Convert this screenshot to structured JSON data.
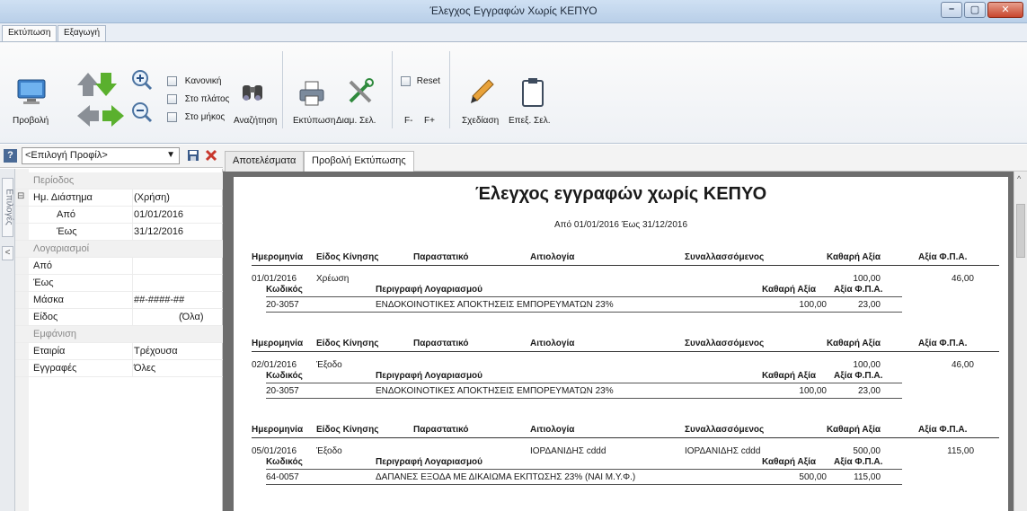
{
  "window": {
    "title": "Έλεγχος Εγγραφών Χωρίς ΚΕΠΥΟ"
  },
  "ribbon_tabs": [
    "Εκτύπωση",
    "Εξαγωγή"
  ],
  "ribbon": {
    "preview": "Προβολή",
    "zoom_normal": "Κανονική",
    "zoom_width": "Στο πλάτος",
    "zoom_length": "Στο μήκος",
    "search": "Αναζήτηση",
    "print": "Εκτύπωση",
    "page_setup": "Διαμ. Σελ.",
    "reset": "Reset",
    "font_minus": "F-",
    "font_plus": "F+",
    "design": "Σχεδίαση",
    "select_page": "Επεξ. Σελ."
  },
  "profile": {
    "selected": "<Επιλογή Προφίλ>"
  },
  "side_tab": "Επιλογές",
  "properties": [
    {
      "type": "cat",
      "key": "Περίοδος"
    },
    {
      "type": "row",
      "key": "Ημ. Διάστημα",
      "value": "(Χρήση)",
      "expand": "⊟"
    },
    {
      "type": "row",
      "key": "Από",
      "value": "01/01/2016",
      "indent": true
    },
    {
      "type": "row",
      "key": "Έως",
      "value": "31/12/2016",
      "indent": true
    },
    {
      "type": "cat",
      "key": "Λογαριασμοί"
    },
    {
      "type": "row",
      "key": "Από",
      "value": ""
    },
    {
      "type": "row",
      "key": "Έως",
      "value": ""
    },
    {
      "type": "row",
      "key": "Μάσκα",
      "value": "##-####-##"
    },
    {
      "type": "row",
      "key": "Είδος",
      "value": "(Όλα)",
      "center": true
    },
    {
      "type": "cat",
      "key": "Εμφάνιση"
    },
    {
      "type": "row",
      "key": "Εταιρία",
      "value": "Τρέχουσα"
    },
    {
      "type": "row",
      "key": "Εγγραφές",
      "value": "Όλες"
    }
  ],
  "doc_tabs": [
    "Αποτελέσματα",
    "Προβολή Εκτύπωσης"
  ],
  "report": {
    "title": "Έλεγχος εγγραφών χωρίς ΚΕΠΥΟ",
    "subtitle": "Από 01/01/2016 Έως 31/12/2016",
    "headers": {
      "date": "Ημερομηνία",
      "movement": "Είδος Κίνησης",
      "document": "Παραστατικό",
      "reason": "Αιτιολογία",
      "party": "Συναλλασσόμενος",
      "net": "Καθαρή Αξία",
      "vat": "Αξία Φ.Π.Α."
    },
    "sub_headers": {
      "code": "Κωδικός",
      "account_desc": "Περιγραφή Λογαριασμού",
      "net": "Καθαρή Αξία",
      "vat": "Αξία Φ.Π.Α."
    },
    "entries": [
      {
        "date": "01/01/2016",
        "movement": "Χρέωση",
        "reason": "",
        "party": "",
        "net": "100,00",
        "vat": "46,00",
        "code": "20-3057",
        "desc": "ΕΝΔΟΚΟΙΝΟΤΙΚΕΣ ΑΠΟΚΤΗΣΕΙΣ ΕΜΠΟΡΕΥΜΑΤΩΝ 23%",
        "line_net": "100,00",
        "line_vat": "23,00"
      },
      {
        "date": "02/01/2016",
        "movement": "Έξοδο",
        "reason": "",
        "party": "",
        "net": "100,00",
        "vat": "46,00",
        "code": "20-3057",
        "desc": "ΕΝΔΟΚΟΙΝΟΤΙΚΕΣ ΑΠΟΚΤΗΣΕΙΣ ΕΜΠΟΡΕΥΜΑΤΩΝ 23%",
        "line_net": "100,00",
        "line_vat": "23,00"
      },
      {
        "date": "05/01/2016",
        "movement": "Έξοδο",
        "reason": "ΙΟΡΔΑΝΙΔΗΣ cddd",
        "party": "ΙΟΡΔΑΝΙΔΗΣ cddd",
        "net": "500,00",
        "vat": "115,00",
        "code": "64-0057",
        "desc": "ΔΑΠΑΝΕΣ ΕΞΟΔΑ ΜΕ ΔΙΚΑΙΩΜΑ ΕΚΠΤΩΣΗΣ 23% (ΝΑΙ Μ.Υ.Φ.)",
        "line_net": "500,00",
        "line_vat": "115,00"
      }
    ]
  }
}
